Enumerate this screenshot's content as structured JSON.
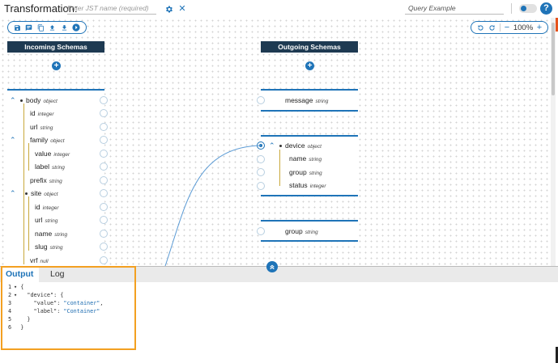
{
  "header": {
    "title": "Transformation:",
    "name_placeholder": "Enter JST name (required)",
    "query_value": "Query Example"
  },
  "toolbar": {
    "icons": [
      "save-icon",
      "comment-icon",
      "copy-icon",
      "upload-icon",
      "download-icon",
      "play-icon"
    ]
  },
  "zoom": {
    "level": "100%"
  },
  "incoming": {
    "header": "Incoming Schemas",
    "rows": [
      {
        "name": "body",
        "type": "object"
      },
      {
        "name": "id",
        "type": "integer"
      },
      {
        "name": "url",
        "type": "string"
      },
      {
        "name": "family",
        "type": "object"
      },
      {
        "name": "value",
        "type": "integer"
      },
      {
        "name": "label",
        "type": "string"
      },
      {
        "name": "prefix",
        "type": "string"
      },
      {
        "name": "site",
        "type": "object"
      },
      {
        "name": "id",
        "type": "integer"
      },
      {
        "name": "url",
        "type": "string"
      },
      {
        "name": "name",
        "type": "string"
      },
      {
        "name": "slug",
        "type": "string"
      },
      {
        "name": "vrf",
        "type": "null"
      }
    ]
  },
  "outgoing": {
    "header": "Outgoing Schemas",
    "message": {
      "name": "message",
      "type": "string"
    },
    "device": {
      "name": "device",
      "type": "object",
      "children": [
        {
          "name": "name",
          "type": "string"
        },
        {
          "name": "group",
          "type": "string"
        },
        {
          "name": "status",
          "type": "integer"
        }
      ]
    },
    "group": {
      "name": "group",
      "type": "string"
    }
  },
  "bottom": {
    "tabs": [
      "Output",
      "Log"
    ],
    "lines": [
      {
        "n": "1",
        "fold": true,
        "parts": [
          {
            "t": "{",
            "c": "p"
          }
        ]
      },
      {
        "n": "2",
        "fold": true,
        "parts": [
          {
            "t": "  \"device\": {",
            "c": "key"
          }
        ]
      },
      {
        "n": "3",
        "fold": false,
        "parts": [
          {
            "t": "    \"value\": ",
            "c": "key"
          },
          {
            "t": "\"container\"",
            "c": "str"
          },
          {
            "t": ",",
            "c": "p"
          }
        ]
      },
      {
        "n": "4",
        "fold": false,
        "parts": [
          {
            "t": "    \"label\": ",
            "c": "key"
          },
          {
            "t": "\"Container\"",
            "c": "str"
          }
        ]
      },
      {
        "n": "5",
        "fold": false,
        "parts": [
          {
            "t": "  }",
            "c": "p"
          }
        ]
      },
      {
        "n": "6",
        "fold": false,
        "parts": [
          {
            "t": "}",
            "c": "p"
          }
        ]
      }
    ]
  },
  "colors": {
    "accent": "#1f74b8",
    "header_dark": "#1e3a52",
    "focus": "#f3a021",
    "tree_line": "#c9a93c"
  }
}
